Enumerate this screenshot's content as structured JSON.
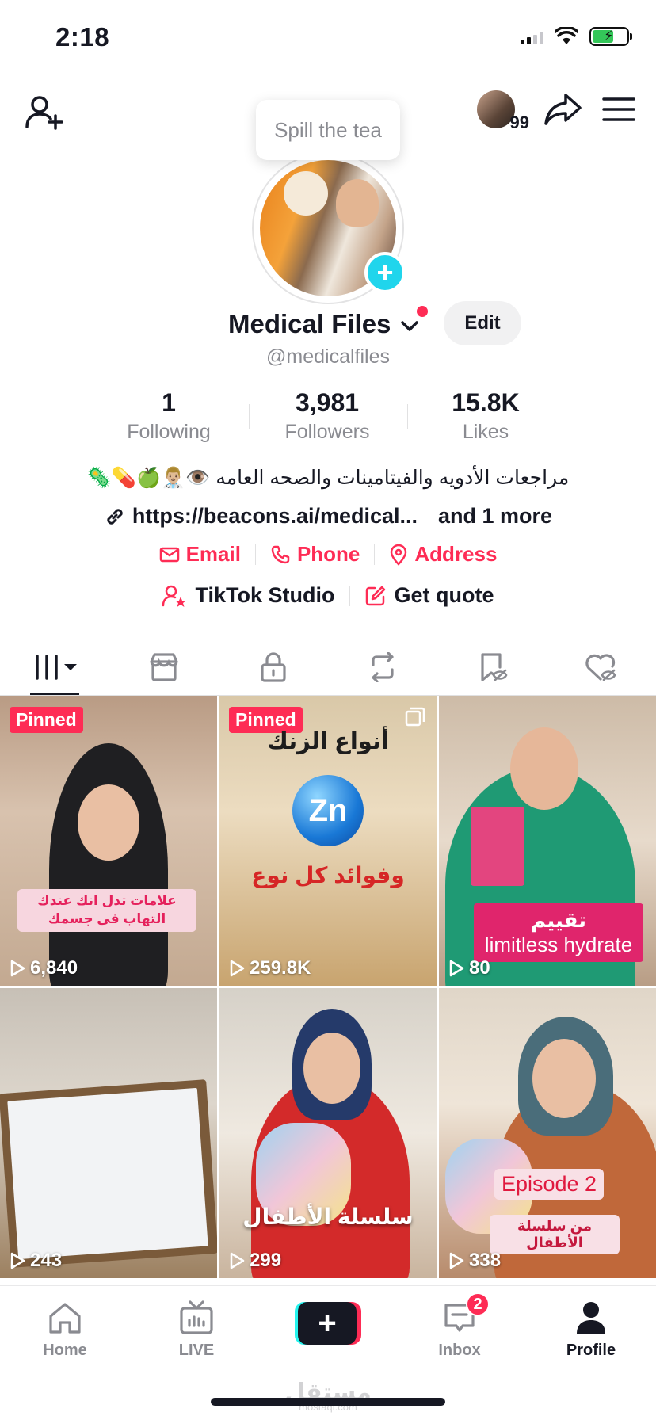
{
  "status_bar": {
    "time": "2:18"
  },
  "top_nav": {
    "avatar_badge": "99"
  },
  "tooltip": "Spill the tea",
  "profile": {
    "name": "Medical Files",
    "edit_label": "Edit",
    "username": "@medicalfiles"
  },
  "stats": [
    {
      "value": "1",
      "label": "Following"
    },
    {
      "value": "3,981",
      "label": "Followers"
    },
    {
      "value": "15.8K",
      "label": "Likes"
    }
  ],
  "bio": "مراجعات الأدويه والفيتامينات والصحه العامه 👁️👨🏼‍⚕️🍏💊🦠",
  "link": {
    "url": "https://beacons.ai/medical...",
    "more": "and 1 more"
  },
  "contacts": {
    "email": "Email",
    "phone": "Phone",
    "address": "Address"
  },
  "tools": {
    "studio": "TikTok Studio",
    "quote": "Get quote"
  },
  "videos": [
    {
      "pinned": "Pinned",
      "views": "6,840",
      "caption": "علامات تدل انك عندك التهاب فى جسمك"
    },
    {
      "pinned": "Pinned",
      "views": "259.8K",
      "caption_top": "أنواع الزنك",
      "caption_mid": "Zn",
      "caption_bottom": "وفوائد كل نوع"
    },
    {
      "views": "80",
      "caption_top": "تقييم",
      "caption_bottom": "limitless hydrate"
    },
    {
      "views": "243"
    },
    {
      "views": "299",
      "caption": "سلسلة الأطفال"
    },
    {
      "views": "338",
      "caption_top": "Episode 2",
      "caption_bottom": "من سلسلة الأطفال"
    }
  ],
  "bottom_nav": {
    "home": "Home",
    "live": "LIVE",
    "inbox": "Inbox",
    "inbox_badge": "2",
    "profile": "Profile"
  },
  "watermark": {
    "main": "مستقل",
    "sub": "mostaql.com"
  },
  "colors": {
    "accent": "#fe2c55",
    "cyan": "#25f4ee",
    "text": "#161823",
    "muted": "#8a8b91"
  }
}
